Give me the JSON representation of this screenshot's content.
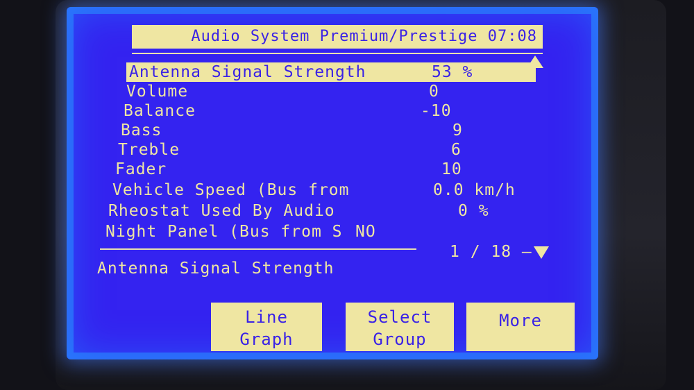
{
  "header": {
    "title": "Audio System Premium/Prestige 07:08"
  },
  "rows": [
    {
      "label": "Antenna Signal Strength",
      "value": "53 %"
    },
    {
      "label": "Volume",
      "value": "0"
    },
    {
      "label": "Balance",
      "value": "-10"
    },
    {
      "label": "Bass",
      "value": "9"
    },
    {
      "label": "Treble",
      "value": "6"
    },
    {
      "label": "Fader",
      "value": "10"
    },
    {
      "label": "Vehicle Speed (Bus from",
      "value": "0.0 km/h"
    },
    {
      "label": "Rheostat Used By Audio",
      "value": "0 %"
    },
    {
      "label": "Night Panel (Bus from S",
      "value": "NO"
    }
  ],
  "selected_row": "Antenna Signal Strength",
  "page": {
    "indicator": "1 / 18 –"
  },
  "description": "Antenna Signal Strength",
  "buttons": {
    "line_graph": {
      "line1": "Line",
      "line2": "Graph"
    },
    "select_group": {
      "line1": "Select",
      "line2": "Group"
    },
    "more": {
      "label": "More"
    }
  },
  "icons": {
    "scroll_up": "up-triangle-icon",
    "scroll_down": "down-triangle-icon"
  },
  "colors": {
    "screen_bg": "#3423f0",
    "highlight": "#efe6a2",
    "text_selected": "#3a22e6"
  }
}
